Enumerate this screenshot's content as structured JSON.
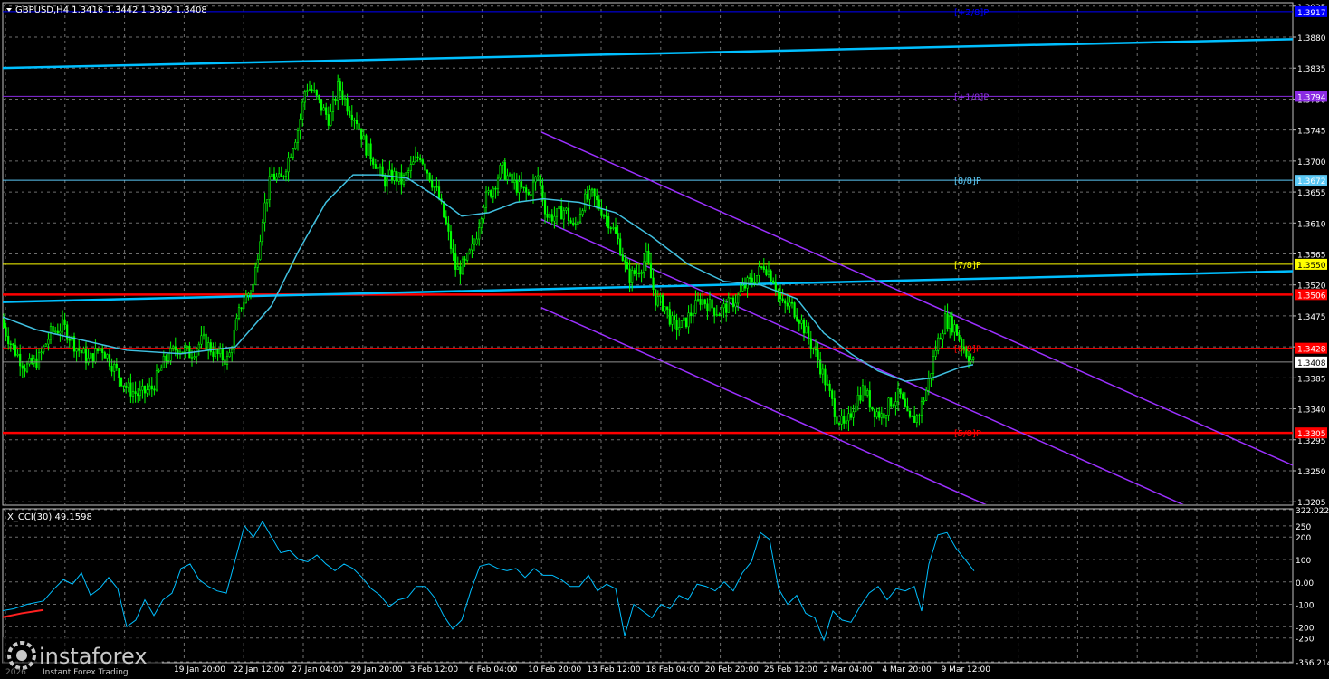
{
  "header": {
    "symbol_line": "GBPUSD,H4  1.3416 1.3442 1.3392 1.3408",
    "cci_label": "X_CCI(30) 49.1598"
  },
  "watermark": {
    "brand": "instaforex",
    "tagline": "Instant Forex Trading",
    "date_partial": "2026"
  },
  "chart_data": [
    {
      "type": "candlestick",
      "title": "GBPUSD,H4",
      "ohlc_last": {
        "open": 1.3416,
        "high": 1.3442,
        "low": 1.3392,
        "close": 1.3408
      },
      "y_ticks": [
        "1.3925",
        "1.3880",
        "1.3835",
        "1.3790",
        "1.3745",
        "1.3700",
        "1.3655",
        "1.3610",
        "1.3565",
        "1.3520",
        "1.3475",
        "1.3430",
        "1.3385",
        "1.3340",
        "1.3295",
        "1.3250",
        "1.3205"
      ],
      "ylim": [
        1.32,
        1.393
      ],
      "x_ticks": [
        "19 Jan 20:00",
        "22 Jan 12:00",
        "27 Jan 04:00",
        "29 Jan 20:00",
        "3 Feb 12:00",
        "6 Feb 04:00",
        "10 Feb 20:00",
        "13 Feb 12:00",
        "18 Feb 04:00",
        "20 Feb 20:00",
        "25 Feb 12:00",
        "2 Mar 04:00",
        "4 Mar 20:00",
        "9 Mar 12:00"
      ],
      "price_path": [
        [
          0,
          1.347
        ],
        [
          14,
          1.343
        ],
        [
          28,
          1.34
        ],
        [
          42,
          1.341
        ],
        [
          56,
          1.345
        ],
        [
          70,
          1.346
        ],
        [
          84,
          1.343
        ],
        [
          98,
          1.341
        ],
        [
          112,
          1.343
        ],
        [
          126,
          1.34
        ],
        [
          140,
          1.337
        ],
        [
          154,
          1.336
        ],
        [
          168,
          1.337
        ],
        [
          182,
          1.341
        ],
        [
          196,
          1.343
        ],
        [
          210,
          1.342
        ],
        [
          224,
          1.344
        ],
        [
          238,
          1.342
        ],
        [
          252,
          1.341
        ],
        [
          266,
          1.349
        ],
        [
          280,
          1.352
        ],
        [
          290,
          1.362
        ],
        [
          300,
          1.368
        ],
        [
          310,
          1.367
        ],
        [
          320,
          1.371
        ],
        [
          330,
          1.375
        ],
        [
          338,
          1.381
        ],
        [
          346,
          1.38
        ],
        [
          354,
          1.378
        ],
        [
          364,
          1.376
        ],
        [
          374,
          1.381
        ],
        [
          384,
          1.378
        ],
        [
          394,
          1.376
        ],
        [
          404,
          1.372
        ],
        [
          414,
          1.37
        ],
        [
          424,
          1.367
        ],
        [
          434,
          1.368
        ],
        [
          444,
          1.367
        ],
        [
          454,
          1.369
        ],
        [
          464,
          1.371
        ],
        [
          474,
          1.368
        ],
        [
          484,
          1.365
        ],
        [
          494,
          1.36
        ],
        [
          504,
          1.354
        ],
        [
          514,
          1.355
        ],
        [
          524,
          1.358
        ],
        [
          534,
          1.364
        ],
        [
          544,
          1.366
        ],
        [
          554,
          1.369
        ],
        [
          564,
          1.367
        ],
        [
          574,
          1.366
        ],
        [
          584,
          1.365
        ],
        [
          594,
          1.368
        ],
        [
          604,
          1.362
        ],
        [
          614,
          1.362
        ],
        [
          624,
          1.363
        ],
        [
          634,
          1.36
        ],
        [
          644,
          1.364
        ],
        [
          654,
          1.365
        ],
        [
          664,
          1.363
        ],
        [
          674,
          1.361
        ],
        [
          684,
          1.358
        ],
        [
          694,
          1.353
        ],
        [
          704,
          1.354
        ],
        [
          714,
          1.356
        ],
        [
          724,
          1.35
        ],
        [
          734,
          1.349
        ],
        [
          744,
          1.346
        ],
        [
          754,
          1.346
        ],
        [
          764,
          1.348
        ],
        [
          774,
          1.35
        ],
        [
          784,
          1.349
        ],
        [
          794,
          1.348
        ],
        [
          804,
          1.349
        ],
        [
          814,
          1.35
        ],
        [
          824,
          1.352
        ],
        [
          834,
          1.353
        ],
        [
          844,
          1.355
        ],
        [
          854,
          1.353
        ],
        [
          864,
          1.349
        ],
        [
          874,
          1.349
        ],
        [
          884,
          1.347
        ],
        [
          894,
          1.344
        ],
        [
          904,
          1.341
        ],
        [
          914,
          1.337
        ],
        [
          924,
          1.333
        ],
        [
          934,
          1.331
        ],
        [
          944,
          1.335
        ],
        [
          954,
          1.337
        ],
        [
          964,
          1.334
        ],
        [
          974,
          1.333
        ],
        [
          984,
          1.335
        ],
        [
          994,
          1.336
        ],
        [
          1004,
          1.332
        ],
        [
          1014,
          1.333
        ],
        [
          1024,
          1.337
        ],
        [
          1034,
          1.343
        ],
        [
          1044,
          1.347
        ],
        [
          1054,
          1.346
        ],
        [
          1064,
          1.343
        ],
        [
          1074,
          1.3408
        ]
      ],
      "moving_average": [
        [
          0,
          1.3475
        ],
        [
          40,
          1.3455
        ],
        [
          90,
          1.344
        ],
        [
          140,
          1.3425
        ],
        [
          200,
          1.342
        ],
        [
          260,
          1.343
        ],
        [
          300,
          1.349
        ],
        [
          330,
          1.357
        ],
        [
          360,
          1.364
        ],
        [
          390,
          1.368
        ],
        [
          420,
          1.368
        ],
        [
          450,
          1.3675
        ],
        [
          480,
          1.365
        ],
        [
          510,
          1.362
        ],
        [
          540,
          1.3625
        ],
        [
          570,
          1.364
        ],
        [
          600,
          1.3645
        ],
        [
          640,
          1.364
        ],
        [
          680,
          1.3625
        ],
        [
          720,
          1.359
        ],
        [
          760,
          1.355
        ],
        [
          800,
          1.3525
        ],
        [
          840,
          1.352
        ],
        [
          880,
          1.35
        ],
        [
          910,
          1.345
        ],
        [
          940,
          1.342
        ],
        [
          970,
          1.3395
        ],
        [
          1000,
          1.338
        ],
        [
          1030,
          1.3385
        ],
        [
          1060,
          1.34
        ],
        [
          1075,
          1.3404
        ]
      ],
      "levels": [
        {
          "label": "1.3917",
          "murrey": "[+2/8]P",
          "value": 1.3917,
          "color": "#0000ff"
        },
        {
          "label": "1.3794",
          "murrey": "[+1/8]P",
          "value": 1.3794,
          "color": "#8a2be2"
        },
        {
          "label": "1.3672",
          "murrey": "[8/8]P",
          "value": 1.3672,
          "color": "#5bc8f5"
        },
        {
          "label": "1.3550",
          "murrey": "[7/8]P",
          "value": 1.355,
          "color": "#ffff00"
        },
        {
          "label": "1.3506",
          "murrey": "",
          "value": 1.3506,
          "color": "#ff0000"
        },
        {
          "label": "1.3428",
          "murrey": "[6/8]P",
          "value": 1.3428,
          "color": "#ff0000"
        },
        {
          "label": "1.3305",
          "murrey": "[5/8]P",
          "value": 1.3305,
          "color": "#ff0000"
        }
      ],
      "current_price": "1.3408",
      "trend_lines": [
        {
          "from": [
            0,
            1.3835
          ],
          "to": [
            1430,
            1.3877
          ],
          "color": "#00bfff"
        },
        {
          "from": [
            0,
            1.3495
          ],
          "to": [
            1430,
            1.354
          ],
          "color": "#00bfff"
        }
      ],
      "channel": [
        {
          "from": [
            598,
            1.3742
          ],
          "to": [
            1428,
            1.3258
          ],
          "color": "#9b30ff"
        },
        {
          "from": [
            598,
            1.3615
          ],
          "to": [
            1428,
            1.313
          ],
          "color": "#9b30ff"
        },
        {
          "from": [
            598,
            1.3487
          ],
          "to": [
            1428,
            1.3003
          ],
          "color": "#9b30ff"
        }
      ]
    },
    {
      "type": "line",
      "title": "X_CCI(30) 49.1598",
      "y_ticks": [
        "322.0224",
        "250",
        "200",
        "100",
        "0.00",
        "-100",
        "-200",
        "-250",
        "-356.2149"
      ],
      "ylim": [
        -356.2149,
        322.0224
      ],
      "x_ticks": [
        "19 Jan 20:00",
        "22 Jan 12:00",
        "27 Jan 04:00",
        "29 Jan 20:00",
        "3 Feb 12:00",
        "6 Feb 04:00",
        "10 Feb 20:00",
        "13 Feb 12:00",
        "18 Feb 04:00",
        "20 Feb 20:00",
        "25 Feb 12:00",
        "2 Mar 04:00",
        "4 Mar 20:00",
        "9 Mar 12:00"
      ],
      "series": [
        {
          "color": "#00bfff",
          "points": [
            [
              0,
              -130
            ],
            [
              15,
              -120
            ],
            [
              30,
              -100
            ],
            [
              48,
              -85
            ],
            [
              60,
              -30
            ],
            [
              70,
              10
            ],
            [
              80,
              -10
            ],
            [
              90,
              40
            ],
            [
              100,
              -60
            ],
            [
              110,
              -30
            ],
            [
              120,
              20
            ],
            [
              130,
              -30
            ],
            [
              140,
              -200
            ],
            [
              150,
              -170
            ],
            [
              160,
              -80
            ],
            [
              170,
              -150
            ],
            [
              180,
              -80
            ],
            [
              190,
              -50
            ],
            [
              200,
              60
            ],
            [
              210,
              80
            ],
            [
              220,
              10
            ],
            [
              230,
              -20
            ],
            [
              240,
              -40
            ],
            [
              250,
              -50
            ],
            [
              260,
              100
            ],
            [
              270,
              250
            ],
            [
              280,
              200
            ],
            [
              290,
              270
            ],
            [
              300,
              200
            ],
            [
              310,
              130
            ],
            [
              320,
              140
            ],
            [
              330,
              100
            ],
            [
              340,
              90
            ],
            [
              350,
              120
            ],
            [
              360,
              80
            ],
            [
              370,
              50
            ],
            [
              380,
              80
            ],
            [
              390,
              60
            ],
            [
              400,
              20
            ],
            [
              410,
              -30
            ],
            [
              420,
              -60
            ],
            [
              430,
              -110
            ],
            [
              440,
              -80
            ],
            [
              450,
              -70
            ],
            [
              460,
              -20
            ],
            [
              470,
              -20
            ],
            [
              480,
              -70
            ],
            [
              490,
              -150
            ],
            [
              500,
              -210
            ],
            [
              510,
              -170
            ],
            [
              520,
              -40
            ],
            [
              530,
              70
            ],
            [
              540,
              80
            ],
            [
              550,
              60
            ],
            [
              560,
              50
            ],
            [
              570,
              60
            ],
            [
              580,
              20
            ],
            [
              590,
              60
            ],
            [
              600,
              30
            ],
            [
              610,
              30
            ],
            [
              620,
              10
            ],
            [
              630,
              -20
            ],
            [
              640,
              -20
            ],
            [
              650,
              30
            ],
            [
              660,
              -40
            ],
            [
              670,
              -10
            ],
            [
              680,
              -30
            ],
            [
              690,
              -240
            ],
            [
              700,
              -100
            ],
            [
              710,
              -130
            ],
            [
              720,
              -160
            ],
            [
              730,
              -100
            ],
            [
              740,
              -120
            ],
            [
              750,
              -60
            ],
            [
              760,
              -80
            ],
            [
              770,
              -10
            ],
            [
              780,
              -20
            ],
            [
              790,
              -40
            ],
            [
              800,
              0
            ],
            [
              810,
              -40
            ],
            [
              820,
              40
            ],
            [
              830,
              90
            ],
            [
              840,
              220
            ],
            [
              850,
              190
            ],
            [
              860,
              -30
            ],
            [
              870,
              -100
            ],
            [
              880,
              -60
            ],
            [
              890,
              -140
            ],
            [
              900,
              -160
            ],
            [
              910,
              -260
            ],
            [
              920,
              -130
            ],
            [
              930,
              -170
            ],
            [
              940,
              -180
            ],
            [
              950,
              -110
            ],
            [
              960,
              -50
            ],
            [
              970,
              -20
            ],
            [
              980,
              -80
            ],
            [
              990,
              -30
            ],
            [
              1000,
              -40
            ],
            [
              1010,
              -20
            ],
            [
              1018,
              -130
            ],
            [
              1026,
              80
            ],
            [
              1036,
              210
            ],
            [
              1046,
              220
            ],
            [
              1056,
              150
            ],
            [
              1066,
              100
            ],
            [
              1076,
              49
            ]
          ]
        },
        {
          "color": "#ff2020",
          "points": [
            [
              0,
              -160
            ],
            [
              24,
              -140
            ],
            [
              48,
              -125
            ]
          ]
        }
      ]
    }
  ]
}
